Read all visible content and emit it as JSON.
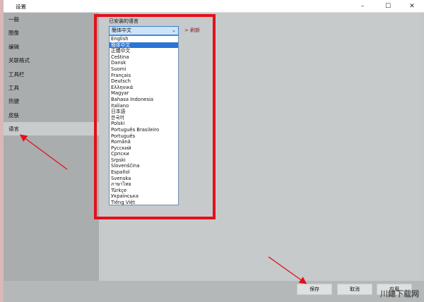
{
  "window": {
    "title": "设置",
    "controls": [
      "–",
      "☐",
      "✕"
    ]
  },
  "sidebar": {
    "items": [
      "一般",
      "图像",
      "编辑",
      "关联格式",
      "工具栏",
      "工具",
      "热键",
      "皮肤",
      "语言"
    ],
    "selected": 8
  },
  "language": {
    "label": "已安装的语言",
    "selected": "簡体中文",
    "refresh": "> 刷新",
    "options": [
      "English",
      "簡体中文",
      "正體中文",
      "Čeština",
      "Dansk",
      "Suomi",
      "Français",
      "Deutsch",
      "Ελληνικά",
      "Magyar",
      "Bahasa Indonesia",
      "Italiano",
      "日本語",
      "한국어",
      "Polski",
      "Português Brasileiro",
      "Português",
      "Română",
      "Русский",
      "Српски",
      "Srpski",
      "Slovenščina",
      "Español",
      "Svenska",
      "ภาษาไทย",
      "Türkçe",
      "Українська",
      "Tiếng Việt"
    ],
    "highlighted": 1
  },
  "buttons": {
    "save": "保存",
    "cancel": "取消",
    "apply": "应用"
  },
  "watermark": "川總下载网"
}
